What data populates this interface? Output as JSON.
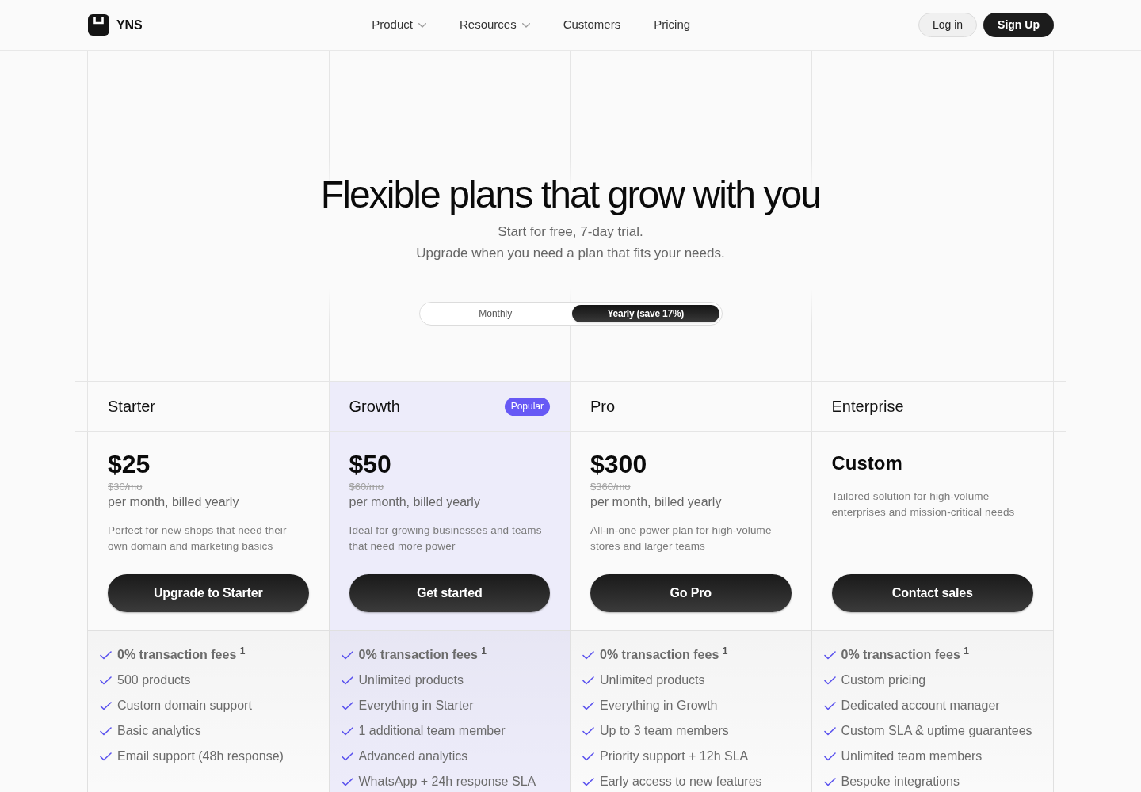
{
  "header": {
    "brand": "YNS",
    "nav": [
      {
        "label": "Product",
        "dropdown": true
      },
      {
        "label": "Resources",
        "dropdown": true
      },
      {
        "label": "Customers",
        "dropdown": false
      },
      {
        "label": "Pricing",
        "dropdown": false
      }
    ],
    "actions": [
      {
        "label": "Log in",
        "kind": "secondary"
      },
      {
        "label": "Sign Up",
        "kind": "primary"
      }
    ]
  },
  "hero": {
    "title": "Flexible plans that grow with you",
    "subtitle_lines": [
      "Start for free, 7-day trial.",
      "Upgrade when you need a plan that fits your needs."
    ]
  },
  "billing_toggle": [
    {
      "label": "Monthly",
      "selected": false
    },
    {
      "label": "Yearly (save 17%)",
      "selected": true
    }
  ],
  "plans": [
    {
      "name": "Starter",
      "highlighted": false,
      "kind": "priced",
      "price": "$25",
      "original_price": "$30/mo",
      "billing": "per month, billed yearly",
      "description": "Perfect for new shops that need their own domain and marketing basics",
      "button": "Upgrade to Starter",
      "features": [
        "**0% transaction fees** $^{1}$",
        "500 products",
        "Custom domain support",
        "Basic analytics",
        "Email support (48h response)"
      ]
    },
    {
      "name": "Growth",
      "badge": "Popular",
      "highlighted": true,
      "kind": "priced",
      "price": "$50",
      "original_price": "$60/mo",
      "billing": "per month, billed yearly",
      "description": "Ideal for growing businesses and teams that need more power",
      "button": "Get started",
      "features": [
        "**0% transaction fees** $^{1}$",
        "Unlimited products",
        "Everything in Starter",
        "1 additional team member",
        "Advanced analytics",
        "WhatsApp + 24h response SLA"
      ]
    },
    {
      "name": "Pro",
      "highlighted": false,
      "kind": "priced",
      "price": "$300",
      "original_price": "$360/mo",
      "billing": "per month, billed yearly",
      "description": "All-in-one power plan for high-volume stores and larger teams",
      "button": "Go Pro",
      "features": [
        "**0% transaction fees** $^{1}$",
        "Unlimited products",
        "Everything in Growth",
        "Up to 3 team members",
        "Priority support + 12h SLA",
        "Early access to new features"
      ]
    },
    {
      "name": "Enterprise",
      "highlighted": false,
      "kind": "custom",
      "price": "Custom",
      "description": "Tailored solution for high-volume enterprises and mission-critical needs",
      "button": "Contact sales",
      "features": [
        "**0% transaction fees** $^{1}$",
        "Custom pricing",
        "Dedicated account manager",
        "Custom SLA & uptime guarantees",
        "Unlimited team members",
        "Bespoke integrations"
      ]
    }
  ]
}
